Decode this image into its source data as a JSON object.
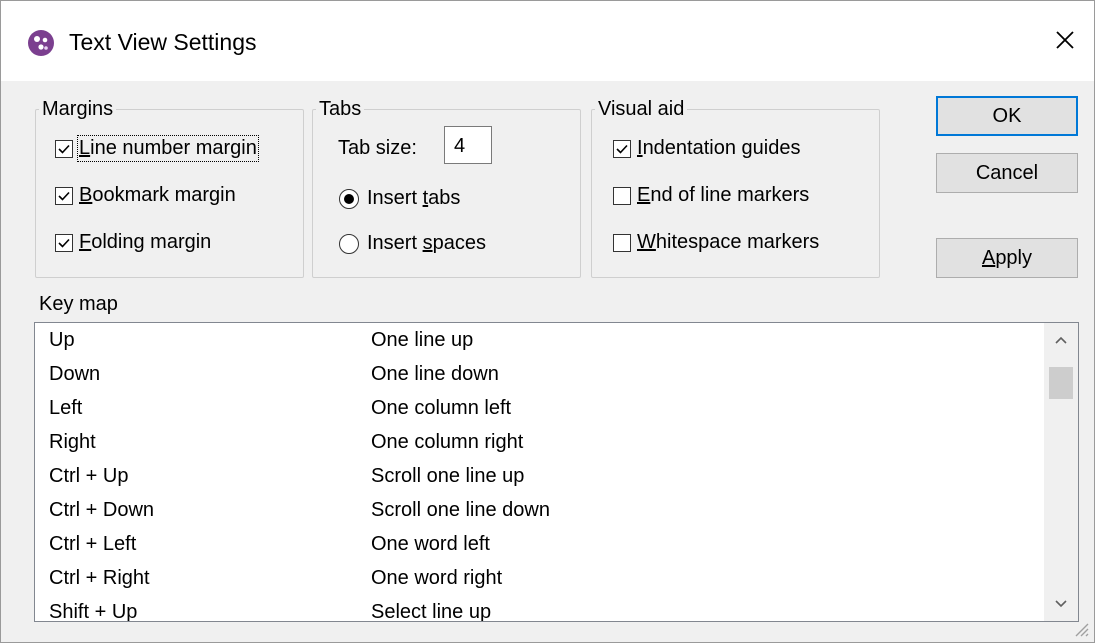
{
  "window": {
    "title": "Text View Settings"
  },
  "margins": {
    "legend": "Margins",
    "items": [
      {
        "pre": "",
        "key": "L",
        "post": "ine number margin",
        "checked": true
      },
      {
        "pre": "",
        "key": "B",
        "post": "ookmark margin",
        "checked": true
      },
      {
        "pre": "",
        "key": "F",
        "post": "olding margin",
        "checked": true
      }
    ]
  },
  "tabs": {
    "legend": "Tabs",
    "tab_size_label": "Tab size:",
    "tab_size_value": "4",
    "options": [
      {
        "pre": "Insert ",
        "key": "t",
        "post": "abs",
        "selected": true
      },
      {
        "pre": "Insert ",
        "key": "s",
        "post": "paces",
        "selected": false
      }
    ]
  },
  "visual_aid": {
    "legend": "Visual aid",
    "items": [
      {
        "pre": "",
        "key": "I",
        "post": "ndentation guides",
        "checked": true
      },
      {
        "pre": "",
        "key": "E",
        "post": "nd of line markers",
        "checked": false
      },
      {
        "pre": "",
        "key": "W",
        "post": "hitespace markers",
        "checked": false
      }
    ]
  },
  "buttons": {
    "ok": "OK",
    "cancel": "Cancel",
    "apply_key": "A",
    "apply_rest": "pply"
  },
  "keymap": {
    "label": "Key map",
    "rows": [
      {
        "key": "Up",
        "action": "One line up"
      },
      {
        "key": "Down",
        "action": "One line down"
      },
      {
        "key": "Left",
        "action": "One column left"
      },
      {
        "key": "Right",
        "action": "One column right"
      },
      {
        "key": "Ctrl + Up",
        "action": "Scroll one line up"
      },
      {
        "key": "Ctrl + Down",
        "action": "Scroll one line down"
      },
      {
        "key": "Ctrl + Left",
        "action": "One word left"
      },
      {
        "key": "Ctrl + Right",
        "action": "One word right"
      },
      {
        "key": "Shift + Up",
        "action": "Select line up"
      }
    ]
  },
  "icons": {
    "app": "app-logo-icon",
    "close": "close-icon",
    "scroll_up": "chevron-up-icon",
    "scroll_down": "chevron-down-icon"
  }
}
